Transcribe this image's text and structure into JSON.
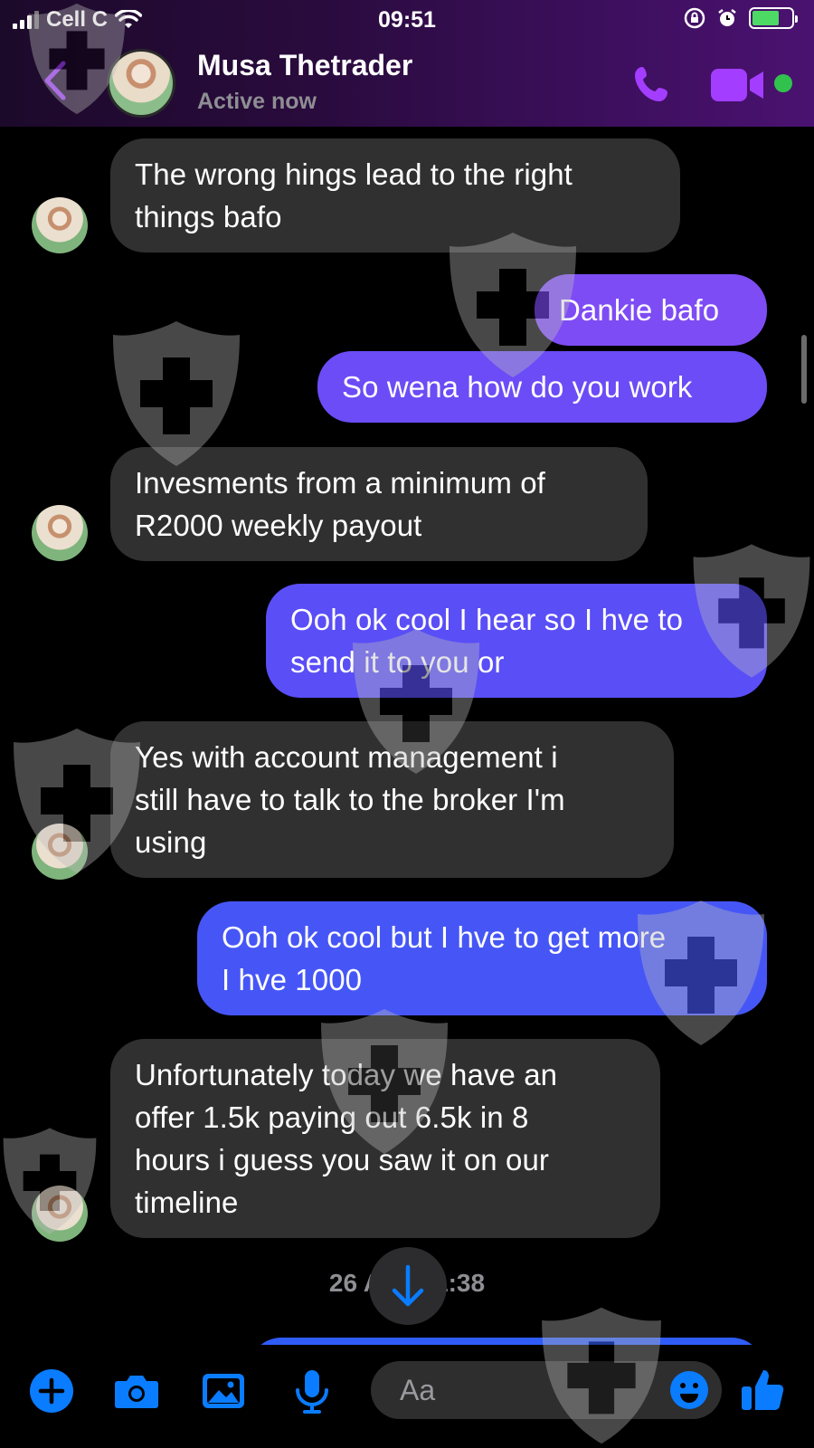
{
  "status_bar": {
    "carrier": "Cell C",
    "time": "09:51"
  },
  "header": {
    "contact_name": "Musa Thetrader",
    "contact_status": "Active now"
  },
  "messages": [
    {
      "from": "contact",
      "text_lines": [
        "The wrong hings lead to the right",
        "things bafo"
      ]
    },
    {
      "from": "me",
      "text_lines": [
        "Dankie bafo"
      ]
    },
    {
      "from": "me",
      "text_lines": [
        "So wena how do you work"
      ]
    },
    {
      "from": "contact",
      "text_lines": [
        "Invesments from a minimum of",
        "R2000 weekly payout"
      ]
    },
    {
      "from": "me",
      "text_lines": [
        "Ooh ok cool I hear so I hve to",
        "send it to you or"
      ]
    },
    {
      "from": "contact",
      "text_lines": [
        "Yes with account management  i",
        "still have to talk to the broker I'm",
        "using"
      ]
    },
    {
      "from": "me",
      "text_lines": [
        "Ooh ok cool but I hve to get more",
        "I hve 1000"
      ]
    },
    {
      "from": "contact",
      "text_lines": [
        "Unfortunately today we have an",
        "offer 1.5k paying out 6.5k in 8",
        "hours i guess you saw it on our",
        "timeline"
      ]
    }
  ],
  "timestamp": {
    "left": "26 A",
    "right": "1:38"
  },
  "composer": {
    "placeholder": "Aa"
  },
  "colors": {
    "accent_purple": "#a33dff",
    "messenger_blue": "#0a7cff",
    "incoming_bubble": "#303030",
    "online_green": "#31c24d"
  },
  "icons": [
    "back-chevron-icon",
    "phone-icon",
    "video-camera-icon",
    "plus-icon",
    "camera-icon",
    "gallery-icon",
    "microphone-icon",
    "emoji-icon",
    "thumbs-up-icon",
    "arrow-down-icon",
    "wifi-icon",
    "alarm-icon",
    "orientation-lock-icon",
    "battery-icon"
  ]
}
